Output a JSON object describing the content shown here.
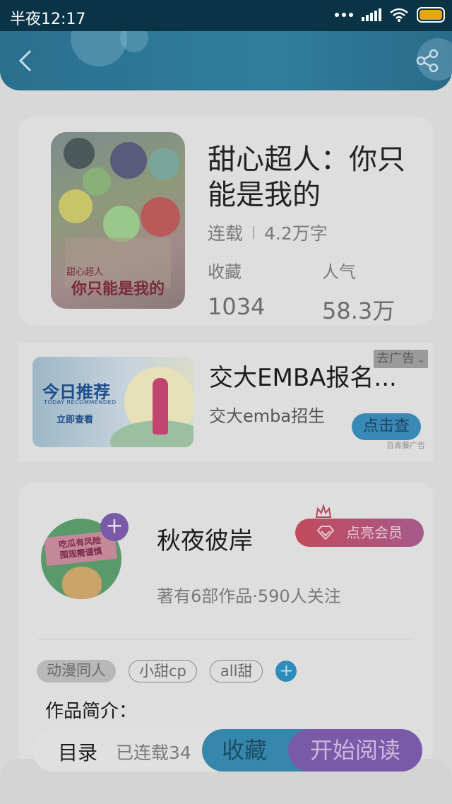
{
  "status_bar": {
    "time": "半夜12:17"
  },
  "header": {
    "back_icon": "chevron-left-icon",
    "share_icon": "share-icon"
  },
  "book": {
    "title": "甜心超人：你只能是我的",
    "status": "连载",
    "word_count": "4.2万字",
    "favorites_label": "收藏",
    "favorites_value": "1034",
    "popularity_label": "人气",
    "popularity_value": "58.3万",
    "cover": {
      "title_text": "你只能是我的",
      "sub_text": "甜心超人"
    }
  },
  "ad": {
    "image_title": "今日推荐",
    "image_subtitle": "TODAY RECOMMENDED",
    "image_button": "立即查看",
    "title": "交大EMBA报名...",
    "subtitle": "交大emba招生",
    "dismiss_label": "去广告",
    "cta_label": "点击查",
    "source": "百青藤广告"
  },
  "author": {
    "name": "秋夜彼岸",
    "meta": "著有6部作品·590人关注",
    "vip_button": "点亮会员",
    "follow_icon": "plus-icon",
    "avatar_sign": "吃瓜有风险\n围观需谨慎",
    "tags": [
      "动漫同人",
      "小甜cp",
      "all甜"
    ],
    "intro_label": "作品简介："
  },
  "bottom_bar": {
    "toc_label": "目录",
    "toc_status": "已连载34",
    "favorite_button": "收藏",
    "read_button": "开始阅读"
  },
  "colors": {
    "header": "#2f7e9d",
    "vip_start": "#c24a5a",
    "vip_end": "#a55a8c",
    "favorite_button": "#3687ac",
    "read_button": "#7a5aa8",
    "tag_add": "#2e8db8"
  }
}
